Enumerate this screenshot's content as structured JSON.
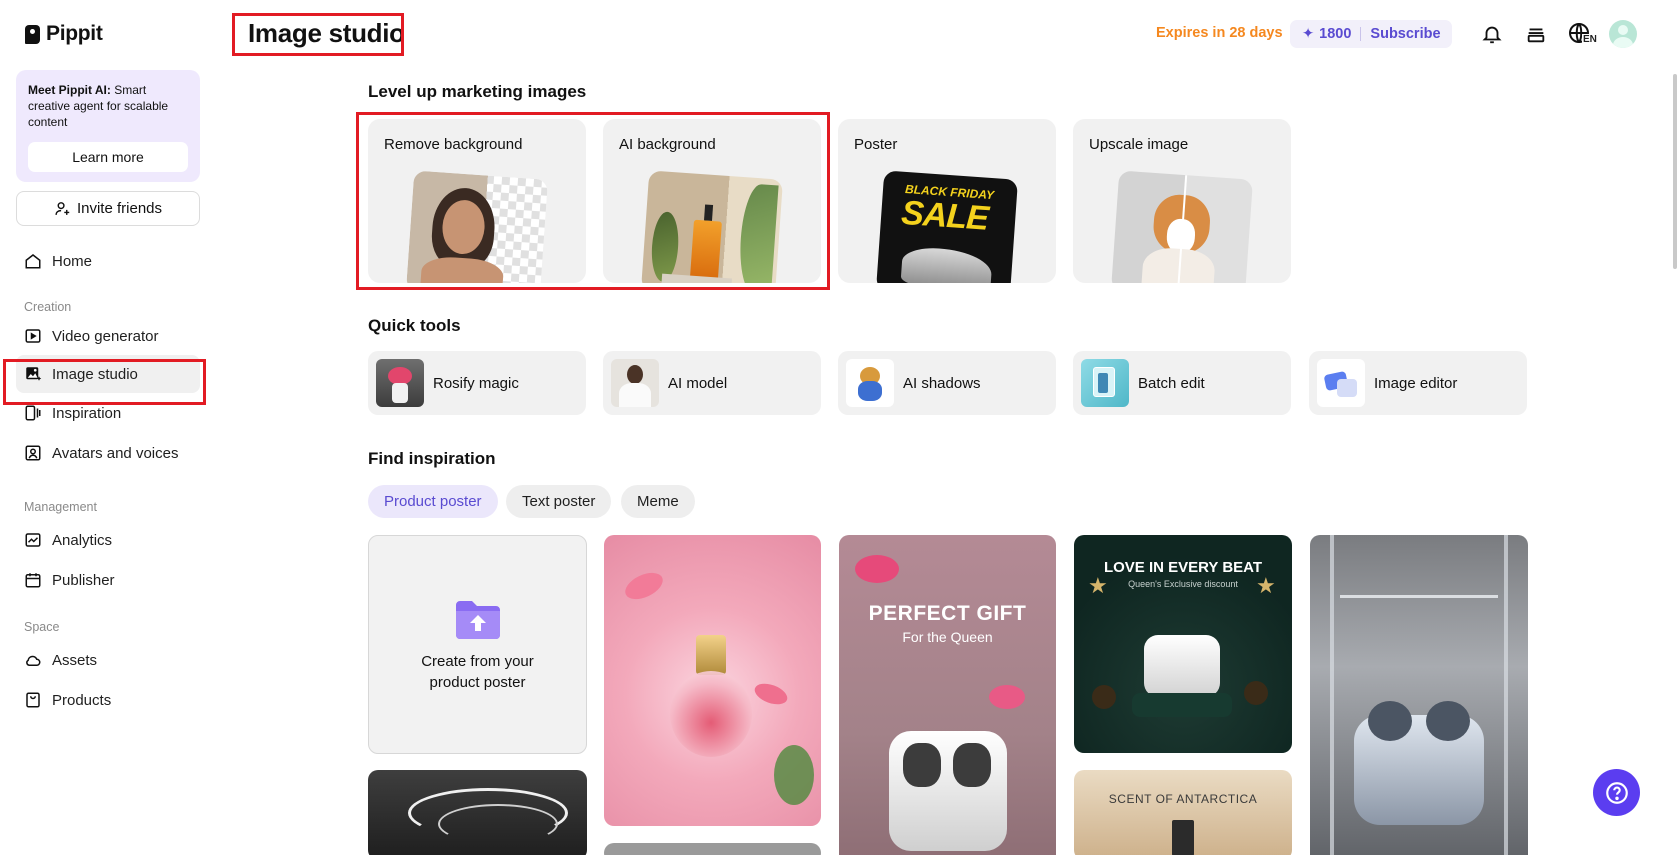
{
  "brand": {
    "name": "Pippit"
  },
  "promo": {
    "bold": "Meet Pippit AI:",
    "text": " Smart creative agent for scalable content",
    "button": "Learn more"
  },
  "invite": {
    "label": "Invite friends"
  },
  "nav": {
    "home": "Home",
    "creation_section": "Creation",
    "video_generator": "Video generator",
    "image_studio": "Image studio",
    "inspiration": "Inspiration",
    "avatars": "Avatars and voices",
    "management_section": "Management",
    "analytics": "Analytics",
    "publisher": "Publisher",
    "space_section": "Space",
    "assets": "Assets",
    "products": "Products"
  },
  "header": {
    "title": "Image studio",
    "expires": "Expires in 28 days",
    "credits": "1800",
    "subscribe": "Subscribe",
    "language": "EN"
  },
  "level_up": {
    "title": "Level up marketing images",
    "cards": [
      "Remove background",
      "AI background",
      "Poster",
      "Upscale image"
    ]
  },
  "poster_art": {
    "line1": "BLACK FRIDAY",
    "line2": "SALE"
  },
  "quick_tools": {
    "title": "Quick tools",
    "items": [
      "Rosify magic",
      "AI model",
      "AI shadows",
      "Batch edit",
      "Image editor"
    ]
  },
  "find_inspiration": {
    "title": "Find inspiration",
    "chips": [
      "Product poster",
      "Text poster",
      "Meme"
    ],
    "create_text": "Create from your product poster"
  },
  "gallery_text": {
    "perfect_gift": "PERFECT GIFT",
    "for_queen": "For the Queen",
    "love_beat": "LOVE IN EVERY BEAT",
    "queen_discount": "Queen's Exclusive discount",
    "scent": "SCENT OF ANTARCTICA"
  },
  "colors": {
    "accent": "#5a4bd1",
    "warning": "#f5881f",
    "highlight": "#e21b23"
  }
}
